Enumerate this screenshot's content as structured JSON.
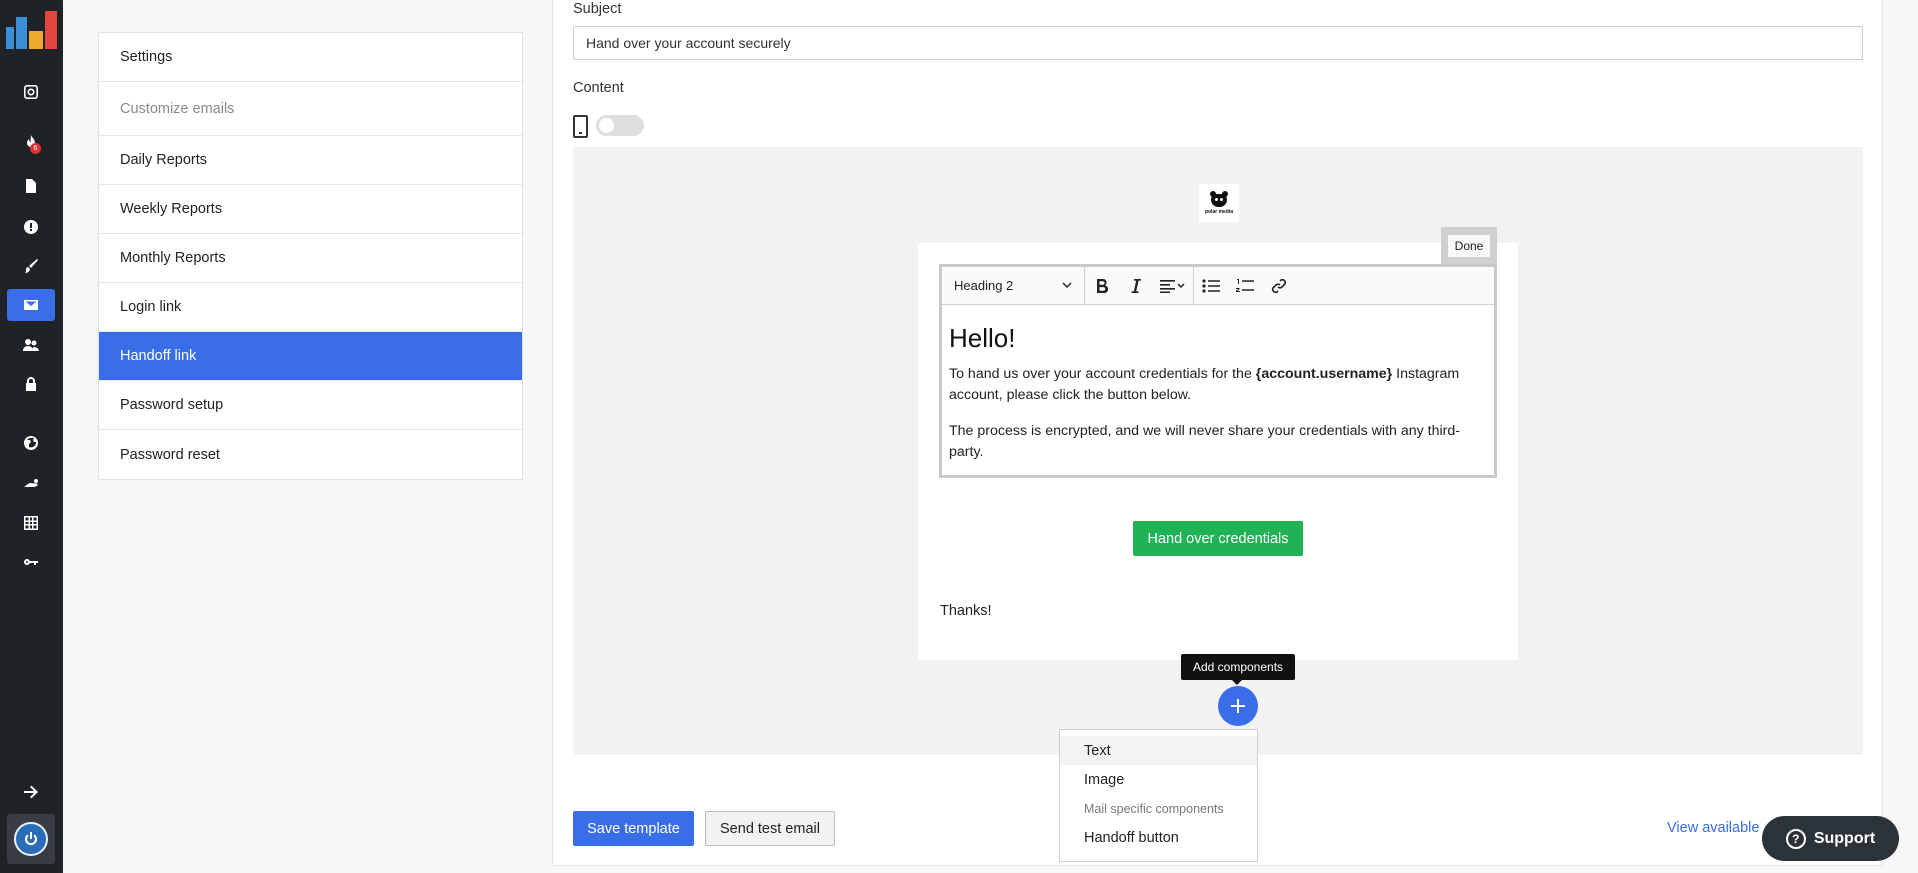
{
  "rail": {
    "icons": [
      "instagram-icon",
      "fire-icon",
      "document-icon",
      "alert-icon",
      "brush-icon",
      "mail-icon",
      "users-icon",
      "lock-icon",
      "globe-icon",
      "speed-icon",
      "grid-icon",
      "key-icon",
      "arrow-right-icon",
      "power-icon"
    ],
    "badge": "6",
    "active_color": "#3a6ee8"
  },
  "menu": {
    "items": [
      {
        "label": "Settings"
      },
      {
        "label": "Customize emails"
      },
      {
        "label": "Daily Reports"
      },
      {
        "label": "Weekly Reports"
      },
      {
        "label": "Monthly Reports"
      },
      {
        "label": "Login link"
      },
      {
        "label": "Handoff link"
      },
      {
        "label": "Password setup"
      },
      {
        "label": "Password reset"
      }
    ]
  },
  "form": {
    "subject_label": "Subject",
    "subject_value": "Hand over your account securely",
    "content_label": "Content"
  },
  "email": {
    "brand_text": "polar media",
    "done_label": "Done",
    "toolbar": {
      "heading_select": "Heading 2"
    },
    "heading": "Hello!",
    "para1_before": "To hand us over your account credentials for the ",
    "para1_bold": "{account.username}",
    "para1_after": " Instagram account, please click the button below.",
    "para2": "The process is encrypted, and we will never share your credentials with any third-party.",
    "cta_label": "Hand over credentials",
    "thanks": "Thanks!"
  },
  "components": {
    "tooltip": "Add components",
    "items": [
      "Text",
      "Image"
    ],
    "group_label": "Mail specific components",
    "group_items": [
      "Handoff button"
    ]
  },
  "footer": {
    "save_label": "Save template",
    "test_label": "Send test email",
    "view_link": "View available",
    "support_label": "Support"
  }
}
